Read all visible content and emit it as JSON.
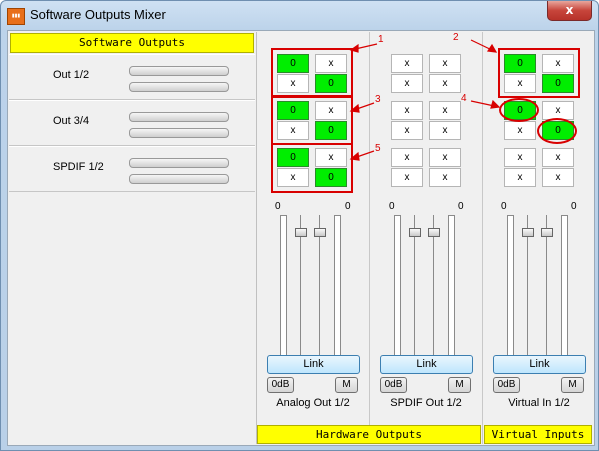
{
  "window": {
    "title": "Software Outputs Mixer",
    "app_icon": "app-icon",
    "close_label": "x"
  },
  "software_outputs": {
    "header": "Software Outputs",
    "rows": [
      {
        "label": "Out 1/2"
      },
      {
        "label": "Out 3/4"
      },
      {
        "label": "SPDIF 1/2"
      }
    ]
  },
  "columns": [
    {
      "name": "Analog Out 1/2",
      "matrix": [
        [
          "0",
          "x",
          "x",
          "0"
        ],
        [
          "0",
          "x",
          "x",
          "0"
        ],
        [
          "0",
          "x",
          "x",
          "0"
        ]
      ],
      "levels": [
        "0",
        "0"
      ],
      "link": "Link",
      "zero_db": "0dB",
      "mute": "M"
    },
    {
      "name": "SPDIF Out 1/2",
      "matrix": [
        [
          "x",
          "x",
          "x",
          "x"
        ],
        [
          "x",
          "x",
          "x",
          "x"
        ],
        [
          "x",
          "x",
          "x",
          "x"
        ]
      ],
      "levels": [
        "0",
        "0"
      ],
      "link": "Link",
      "zero_db": "0dB",
      "mute": "M"
    },
    {
      "name": "Virtual In 1/2",
      "matrix": [
        [
          "0",
          "x",
          "x",
          "0"
        ],
        [
          "0",
          "x",
          "x",
          "0"
        ],
        [
          "x",
          "x",
          "x",
          "x"
        ]
      ],
      "levels": [
        "0",
        "0"
      ],
      "link": "Link",
      "zero_db": "0dB",
      "mute": "M"
    }
  ],
  "footer": {
    "hardware": "Hardware Outputs",
    "virtual": "Virtual Inputs"
  },
  "annotations": [
    "1",
    "2",
    "3",
    "4",
    "5"
  ],
  "colors": {
    "active_cell": "#00ee00",
    "annotation": "#d80000",
    "header_bg": "#ffff00"
  }
}
